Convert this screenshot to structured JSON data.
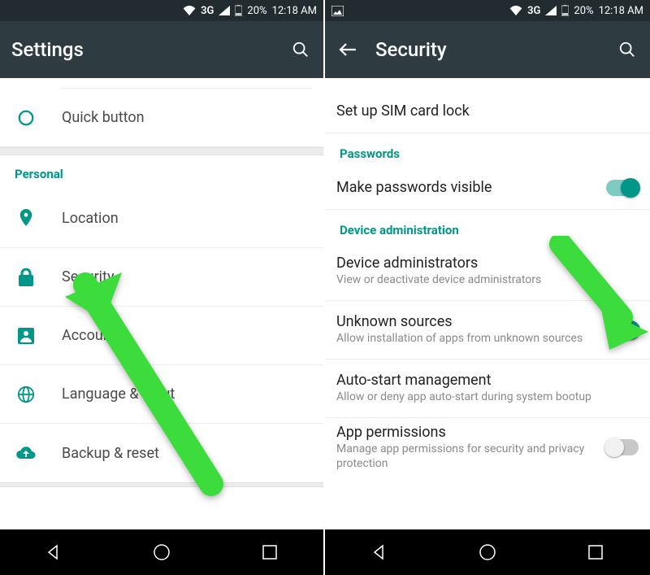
{
  "status": {
    "network": "3G",
    "battery": "20%",
    "time": "12:18 AM"
  },
  "left": {
    "title": "Settings",
    "quick_button": "Quick button",
    "personal_header": "Personal",
    "items": {
      "location": "Location",
      "security": "Security",
      "accounts": "Accounts",
      "language": "Language & input",
      "backup": "Backup & reset"
    }
  },
  "right": {
    "title": "Security",
    "sim_header_cut": "SIM card lock",
    "sim_setup": "Set up SIM card lock",
    "passwords_header": "Passwords",
    "make_passwords_visible": "Make passwords visible",
    "device_admin_header": "Device administration",
    "device_admins": {
      "title": "Device administrators",
      "sub": "View or deactivate device administrators"
    },
    "unknown_sources": {
      "title": "Unknown sources",
      "sub": "Allow installation of apps from unknown sources"
    },
    "autostart": {
      "title": "Auto-start management",
      "sub": "Allow or deny app auto-start during system bootup"
    },
    "app_perms": {
      "title": "App permissions",
      "sub": "Manage app permissions for security and privacy protection"
    }
  }
}
